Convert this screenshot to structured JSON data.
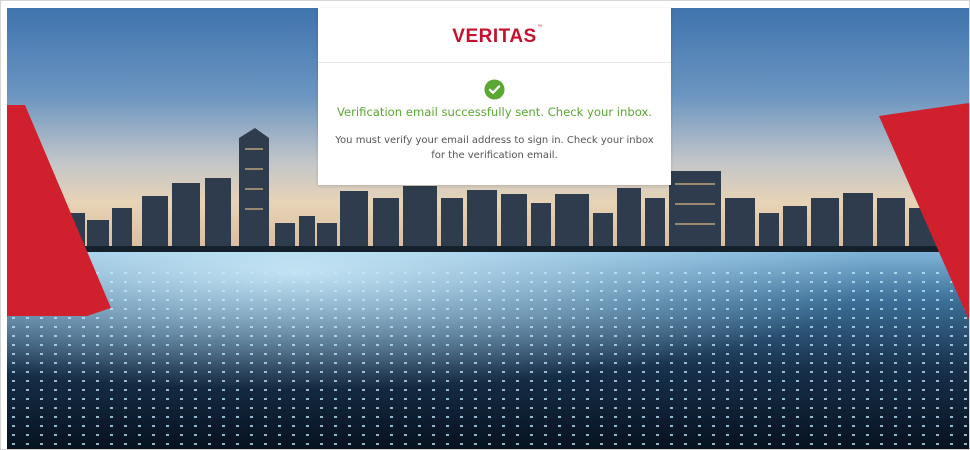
{
  "brand": {
    "logo_text": "VERITAS",
    "logo_trademark": "™",
    "color": "#c8102e"
  },
  "status": {
    "icon": "check-circle-icon",
    "color": "#5aa832",
    "message": "Verification email successfully sent. Check your inbox.",
    "detail": "You must verify your email address to sign in. Check your inbox for the verification email."
  },
  "background": {
    "description_icon": "city-skyline-image"
  }
}
